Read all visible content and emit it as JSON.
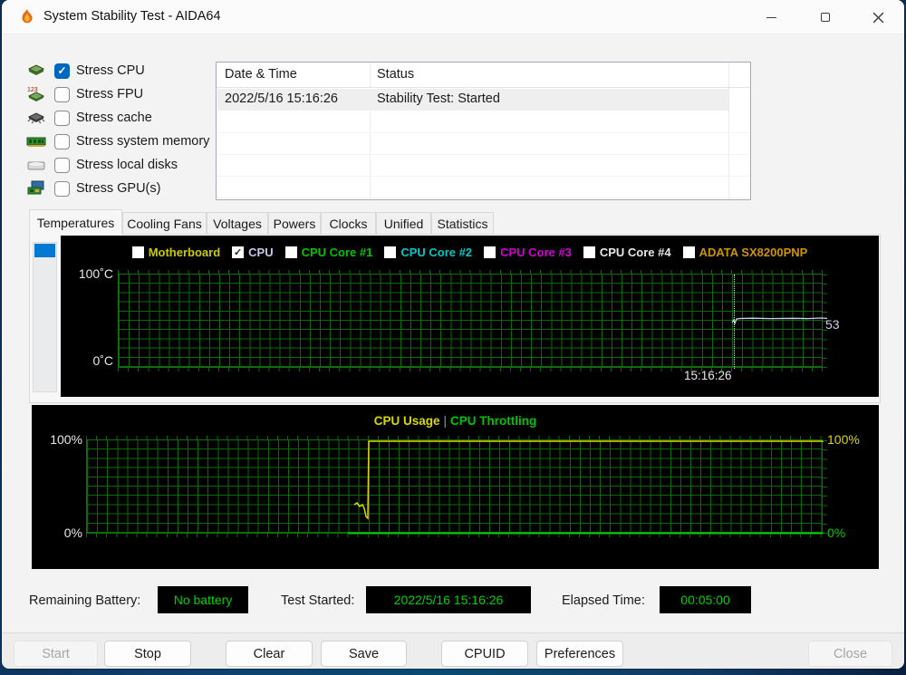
{
  "window": {
    "title": "System Stability Test - AIDA64",
    "app_icon": "flame-icon",
    "controls": {
      "minimize": "minimize",
      "maximize": "maximize",
      "close": "close"
    }
  },
  "stress_options": {
    "items": [
      {
        "label": "Stress CPU",
        "checked": true,
        "icon": "cpu-chip-icon"
      },
      {
        "label": "Stress FPU",
        "checked": false,
        "icon": "fpu-chip-icon"
      },
      {
        "label": "Stress cache",
        "checked": false,
        "icon": "cache-chip-icon"
      },
      {
        "label": "Stress system memory",
        "checked": false,
        "icon": "memory-module-icon"
      },
      {
        "label": "Stress local disks",
        "checked": false,
        "icon": "hard-disk-icon"
      },
      {
        "label": "Stress GPU(s)",
        "checked": false,
        "icon": "gpu-card-icon"
      }
    ],
    "check_glyph": "✓"
  },
  "log_table": {
    "columns": [
      "Date & Time",
      "Status"
    ],
    "rows": [
      {
        "datetime": "2022/5/16 15:16:26",
        "status": "Stability Test: Started",
        "selected": true
      }
    ]
  },
  "tabs": {
    "items": [
      {
        "label": "Temperatures",
        "active": true
      },
      {
        "label": "Cooling Fans",
        "active": false
      },
      {
        "label": "Voltages",
        "active": false
      },
      {
        "label": "Powers",
        "active": false
      },
      {
        "label": "Clocks",
        "active": false
      },
      {
        "label": "Unified",
        "active": false
      },
      {
        "label": "Statistics",
        "active": false
      }
    ]
  },
  "temperature_chart": {
    "legend": [
      {
        "label": "Motherboard",
        "color": "#cbcb00",
        "checked": false
      },
      {
        "label": "CPU",
        "color": "#c2cbee",
        "checked": true
      },
      {
        "label": "CPU Core #1",
        "color": "#00c400",
        "checked": false
      },
      {
        "label": "CPU Core #2",
        "color": "#00c8c8",
        "checked": false
      },
      {
        "label": "CPU Core #3",
        "color": "#d400d4",
        "checked": false
      },
      {
        "label": "CPU Core #4",
        "color": "#e8e8e8",
        "checked": false
      },
      {
        "label": "ADATA SX8200PNP",
        "color": "#cf9400",
        "checked": false
      }
    ],
    "check_glyph": "✓",
    "y_top_label": "100˚C",
    "y_bottom_label": "0˚C",
    "current_value": "53",
    "time_marker": "15:16:26"
  },
  "usage_chart": {
    "title_left": "CPU Usage",
    "title_sep": "|",
    "title_right": "CPU Throttling",
    "left_top_label": "100%",
    "left_bottom_label": "0%",
    "right_top_label": "100%",
    "right_bottom_label": "0%"
  },
  "status_bar": {
    "battery_label": "Remaining Battery:",
    "battery_value": "No battery",
    "test_started_label": "Test Started:",
    "test_started_value": "2022/5/16 15:16:26",
    "elapsed_label": "Elapsed Time:",
    "elapsed_value": "00:05:00"
  },
  "footer": {
    "buttons": [
      {
        "label": "Start",
        "enabled": false
      },
      {
        "label": "Stop",
        "enabled": true
      },
      {
        "label": "Clear",
        "enabled": true
      },
      {
        "label": "Save",
        "enabled": true
      },
      {
        "label": "CPUID",
        "enabled": true
      },
      {
        "label": "Preferences",
        "enabled": true
      },
      {
        "label": "Close",
        "enabled": false
      }
    ]
  },
  "colors": {
    "accent_blue": "#0067c0",
    "scroll_thumb_blue": "#0078d4",
    "chart_bg": "#000000",
    "grid_green": "#0b6b0b",
    "status_green": "#00d000",
    "cpu_line": "#c9d3ec",
    "usage_line_yellow": "#d8d800",
    "throttle_line_green": "#00cc00"
  },
  "chart_data": [
    {
      "type": "line",
      "title": "Temperatures",
      "ylabel": "°C",
      "ylim": [
        0,
        100
      ],
      "grid": true,
      "legend_position": "top",
      "legend": [
        "Motherboard",
        "CPU",
        "CPU Core #1",
        "CPU Core #2",
        "CPU Core #3",
        "CPU Core #4",
        "ADATA SX8200PNP"
      ],
      "visible_series": [
        "CPU"
      ],
      "series": [
        {
          "name": "CPU",
          "color": "#c9d3ec",
          "points": [
            {
              "time": "15:16:26",
              "value": 51
            },
            {
              "time": "after start",
              "value": 53
            },
            {
              "time": "latest",
              "value": 53
            }
          ],
          "current_value": 53
        }
      ],
      "time_marker": "15:16:26",
      "marker_style": "vertical-dotted-line"
    },
    {
      "type": "line",
      "title": "CPU Usage | CPU Throttling",
      "ylim": [
        0,
        100
      ],
      "grid": true,
      "yticks_left": [
        "100%",
        "0%"
      ],
      "yticks_right": [
        "100%",
        "0%"
      ],
      "series": [
        {
          "name": "CPU Usage",
          "color": "#d8d800",
          "points": [
            {
              "x_frac": 0.363,
              "value": 30
            },
            {
              "x_frac": 0.372,
              "value": 27
            },
            {
              "x_frac": 0.378,
              "value": 18
            },
            {
              "x_frac": 0.382,
              "value": 100
            },
            {
              "x_frac": 1.0,
              "value": 100
            }
          ]
        },
        {
          "name": "CPU Throttling",
          "color": "#00cc00",
          "points": [
            {
              "x_frac": 0.355,
              "value": 0
            },
            {
              "x_frac": 1.0,
              "value": 0
            }
          ]
        }
      ]
    }
  ]
}
